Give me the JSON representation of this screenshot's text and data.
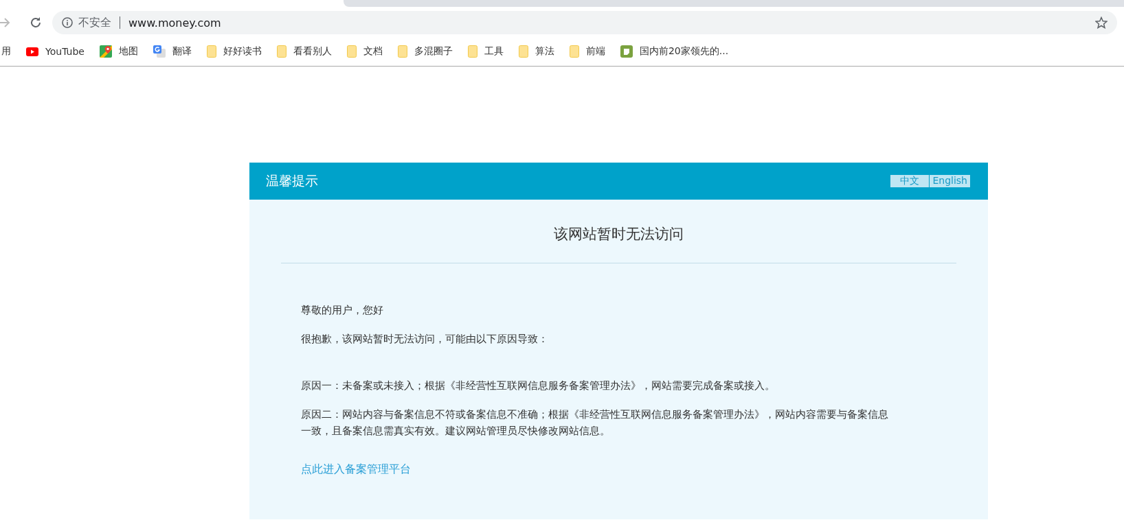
{
  "browser": {
    "security_label": "不安全",
    "url": "www.money.com",
    "forward_disabled": true
  },
  "bookmarks": [
    {
      "kind": "apps",
      "label": "用"
    },
    {
      "kind": "youtube",
      "label": "YouTube"
    },
    {
      "kind": "maps",
      "label": "地图"
    },
    {
      "kind": "translate",
      "label": "翻译"
    },
    {
      "kind": "folder",
      "label": "好好读书"
    },
    {
      "kind": "folder",
      "label": "看看别人"
    },
    {
      "kind": "folder",
      "label": "文档"
    },
    {
      "kind": "folder",
      "label": "多混圈子"
    },
    {
      "kind": "folder",
      "label": "工具"
    },
    {
      "kind": "folder",
      "label": "算法"
    },
    {
      "kind": "folder",
      "label": "前端"
    },
    {
      "kind": "site",
      "label": "国内前20家领先的..."
    }
  ],
  "notice": {
    "header_title": "温馨提示",
    "languages": [
      "中文",
      "English"
    ],
    "heading": "该网站暂时无法访问",
    "paragraphs": [
      {
        "kind": "greeting",
        "text": "尊敬的用户，您好"
      },
      {
        "kind": "intro",
        "text": "很抱歉，该网站暂时无法访问，可能由以下原因导致："
      },
      {
        "kind": "reason",
        "text": "原因一：未备案或未接入；根据《非经营性互联网信息服务备案管理办法》，网站需要完成备案或接入。"
      },
      {
        "kind": "reason",
        "text": "原因二：网站内容与备案信息不符或备案信息不准确；根据《非经营性互联网信息服务备案管理办法》，网站内容需要与备案信息一致，且备案信息需真实有效。建议网站管理员尽快修改网站信息。"
      }
    ],
    "link": "点此进入备案管理平台"
  }
}
